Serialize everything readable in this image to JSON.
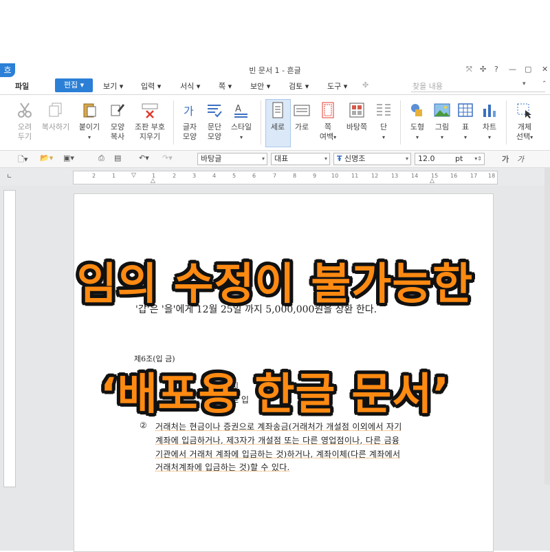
{
  "window": {
    "logo": "흐",
    "title": "빈 문서 1 - 흔글",
    "controls": [
      "⤧",
      "✣",
      "?",
      "—",
      "▢",
      "✕"
    ]
  },
  "menu": {
    "items": [
      "파일",
      "편집",
      "보기",
      "입력",
      "서식",
      "쪽",
      "보안",
      "검토",
      "도구"
    ],
    "active": "편집",
    "search_placeholder": "찾을 내용"
  },
  "ribbon": {
    "cut": [
      "오려",
      "두기"
    ],
    "copy": "복사하기",
    "paste": "붙이기",
    "format_copy": [
      "모양",
      "복사"
    ],
    "insert_symbol": [
      "조판 부호",
      "지우기"
    ],
    "char_shape": [
      "글자",
      "모양"
    ],
    "para_shape": [
      "문단",
      "모양"
    ],
    "style": "스타일",
    "vertical": "세로",
    "horizontal": "가로",
    "margin": [
      "쪽",
      "여백"
    ],
    "background": "바탕쪽",
    "columns": "단",
    "shape": "도형",
    "picture": "그림",
    "table": "표",
    "chart": "차트",
    "object_select": [
      "개체",
      "선택"
    ]
  },
  "toolbar": {
    "style_value": "바탕글",
    "lang_value": "대표",
    "font_value": "신명조",
    "size_value": "12.0",
    "size_unit": "pt",
    "bold_glyph": "가",
    "italic_glyph": "가"
  },
  "ruler": {
    "numbers": [
      "2",
      "1",
      "1",
      "2",
      "3",
      "4",
      "5",
      "6",
      "7",
      "8",
      "9",
      "10",
      "11",
      "12",
      "13",
      "14",
      "15",
      "16",
      "17",
      "18"
    ]
  },
  "document": {
    "line1": "'갑'은 '을'에게 12월 25일 까지 5,000,000원을 상환 한다.",
    "article": "제6조(입 금)",
    "partial_left": "①",
    "partial_mid1": "즉시",
    "partial_mid2": "으로 입",
    "partial_right": "어음",
    "para2_num": "②",
    "para2_lines": [
      "거래처는 현금이나 증권으로 계좌송금(거래처가 개설점 이외에서 자기",
      "계좌에 입금하거나, 제3자가 개설점 또는 다른 영업점이나, 다른 금융",
      "기관에서 거래처 계좌에 입금하는 것)하거나, 계좌이체(다른 계좌에서",
      "거래처계좌에 입금하는 것)할 수 있다."
    ]
  },
  "overlay": {
    "line1": "임의 수정이 불가능한",
    "line2": "‘배포용 한글 문서’"
  }
}
